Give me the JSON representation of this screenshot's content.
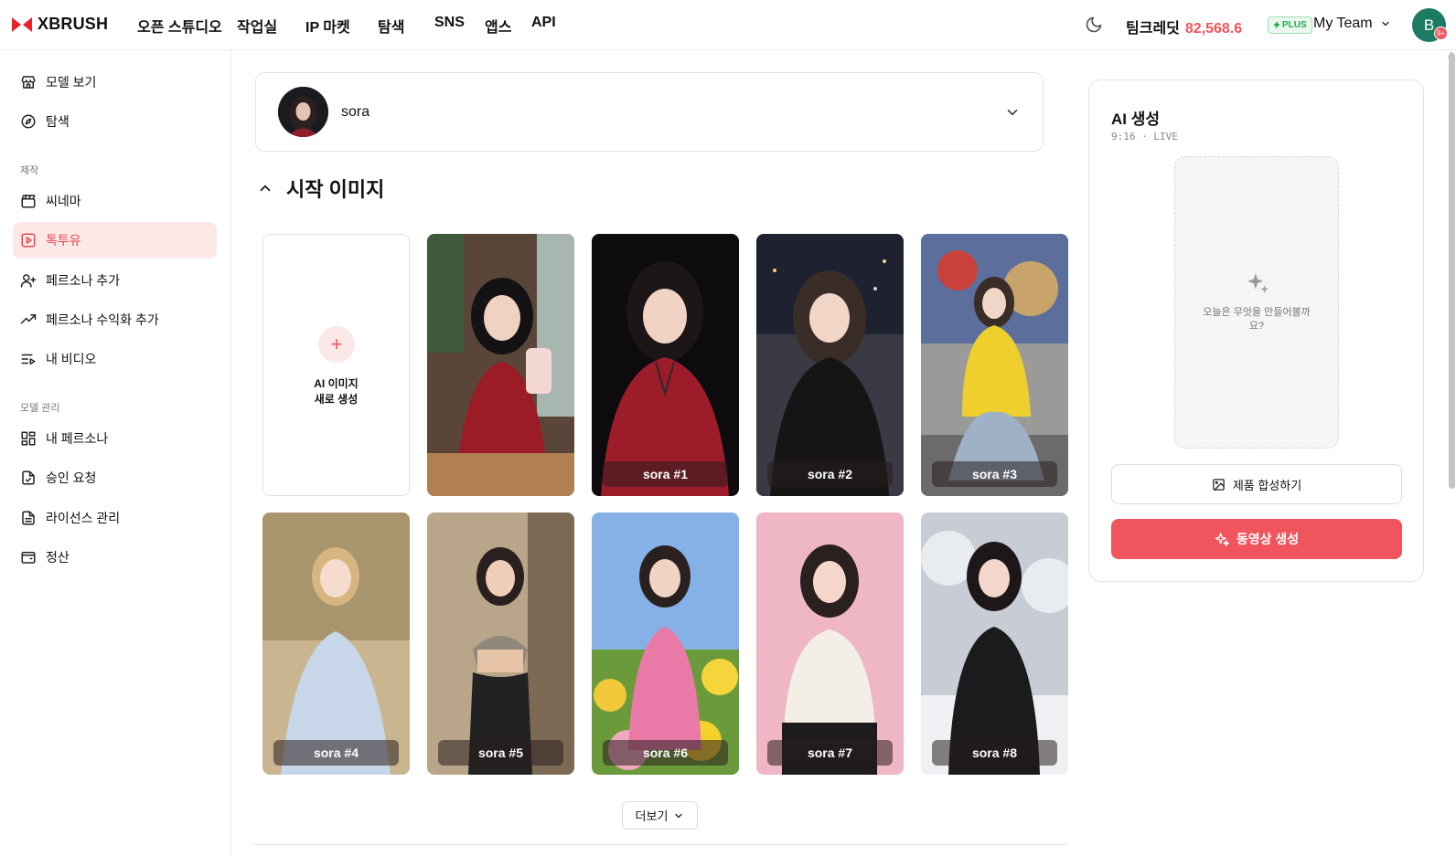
{
  "app": {
    "logo_text": "XBRUSH",
    "brand_color": "#f0545c"
  },
  "nav": {
    "items": [
      "오픈 스튜디오",
      "작업실",
      "IP 마켓",
      "탐색",
      "SNS",
      "앱스",
      "API"
    ]
  },
  "header": {
    "credit_label": "팀크레딧",
    "credit_amount": "82,568.6",
    "plan_badge": "PLUS",
    "team_name": "My Team",
    "avatar_initial": "B",
    "notif_count": "9+"
  },
  "sidebar": {
    "top_items": [
      {
        "label": "모델 보기",
        "icon": "storefront-icon"
      },
      {
        "label": "탐색",
        "icon": "compass-icon"
      }
    ],
    "section_create": "제작",
    "create_items": [
      {
        "label": "씨네마",
        "icon": "clapperboard-icon"
      },
      {
        "label": "톡투유",
        "icon": "play-square-icon",
        "active": true
      },
      {
        "label": "페르소나 추가",
        "icon": "user-plus-icon"
      },
      {
        "label": "페르소나 수익화 추가",
        "icon": "trending-up-icon"
      },
      {
        "label": "내 비디오",
        "icon": "list-video-icon"
      }
    ],
    "section_manage": "모델 관리",
    "manage_items": [
      {
        "label": "내 페르소나",
        "icon": "grid-icon"
      },
      {
        "label": "승인 요청",
        "icon": "file-check-icon"
      },
      {
        "label": "라이선스 관리",
        "icon": "file-text-icon"
      },
      {
        "label": "정산",
        "icon": "wallet-icon"
      }
    ]
  },
  "persona": {
    "selected_name": "sora"
  },
  "start_images": {
    "title": "시작 이미지",
    "new_card_text": "AI 이미지\n새로 생성",
    "cards": [
      {
        "label": ""
      },
      {
        "label": "sora #1"
      },
      {
        "label": "sora #2"
      },
      {
        "label": "sora #3"
      },
      {
        "label": "sora #4"
      },
      {
        "label": "sora #5"
      },
      {
        "label": "sora #6"
      },
      {
        "label": "sora #7"
      },
      {
        "label": "sora #8"
      }
    ],
    "more_label": "더보기"
  },
  "ai_panel": {
    "title": "AI 생성",
    "subtitle": "9:16 · LIVE",
    "preview_text": "오늘은 무엇을 만들어볼까요?",
    "compose_label": "제품 합성하기",
    "generate_label": "동영상 생성"
  }
}
